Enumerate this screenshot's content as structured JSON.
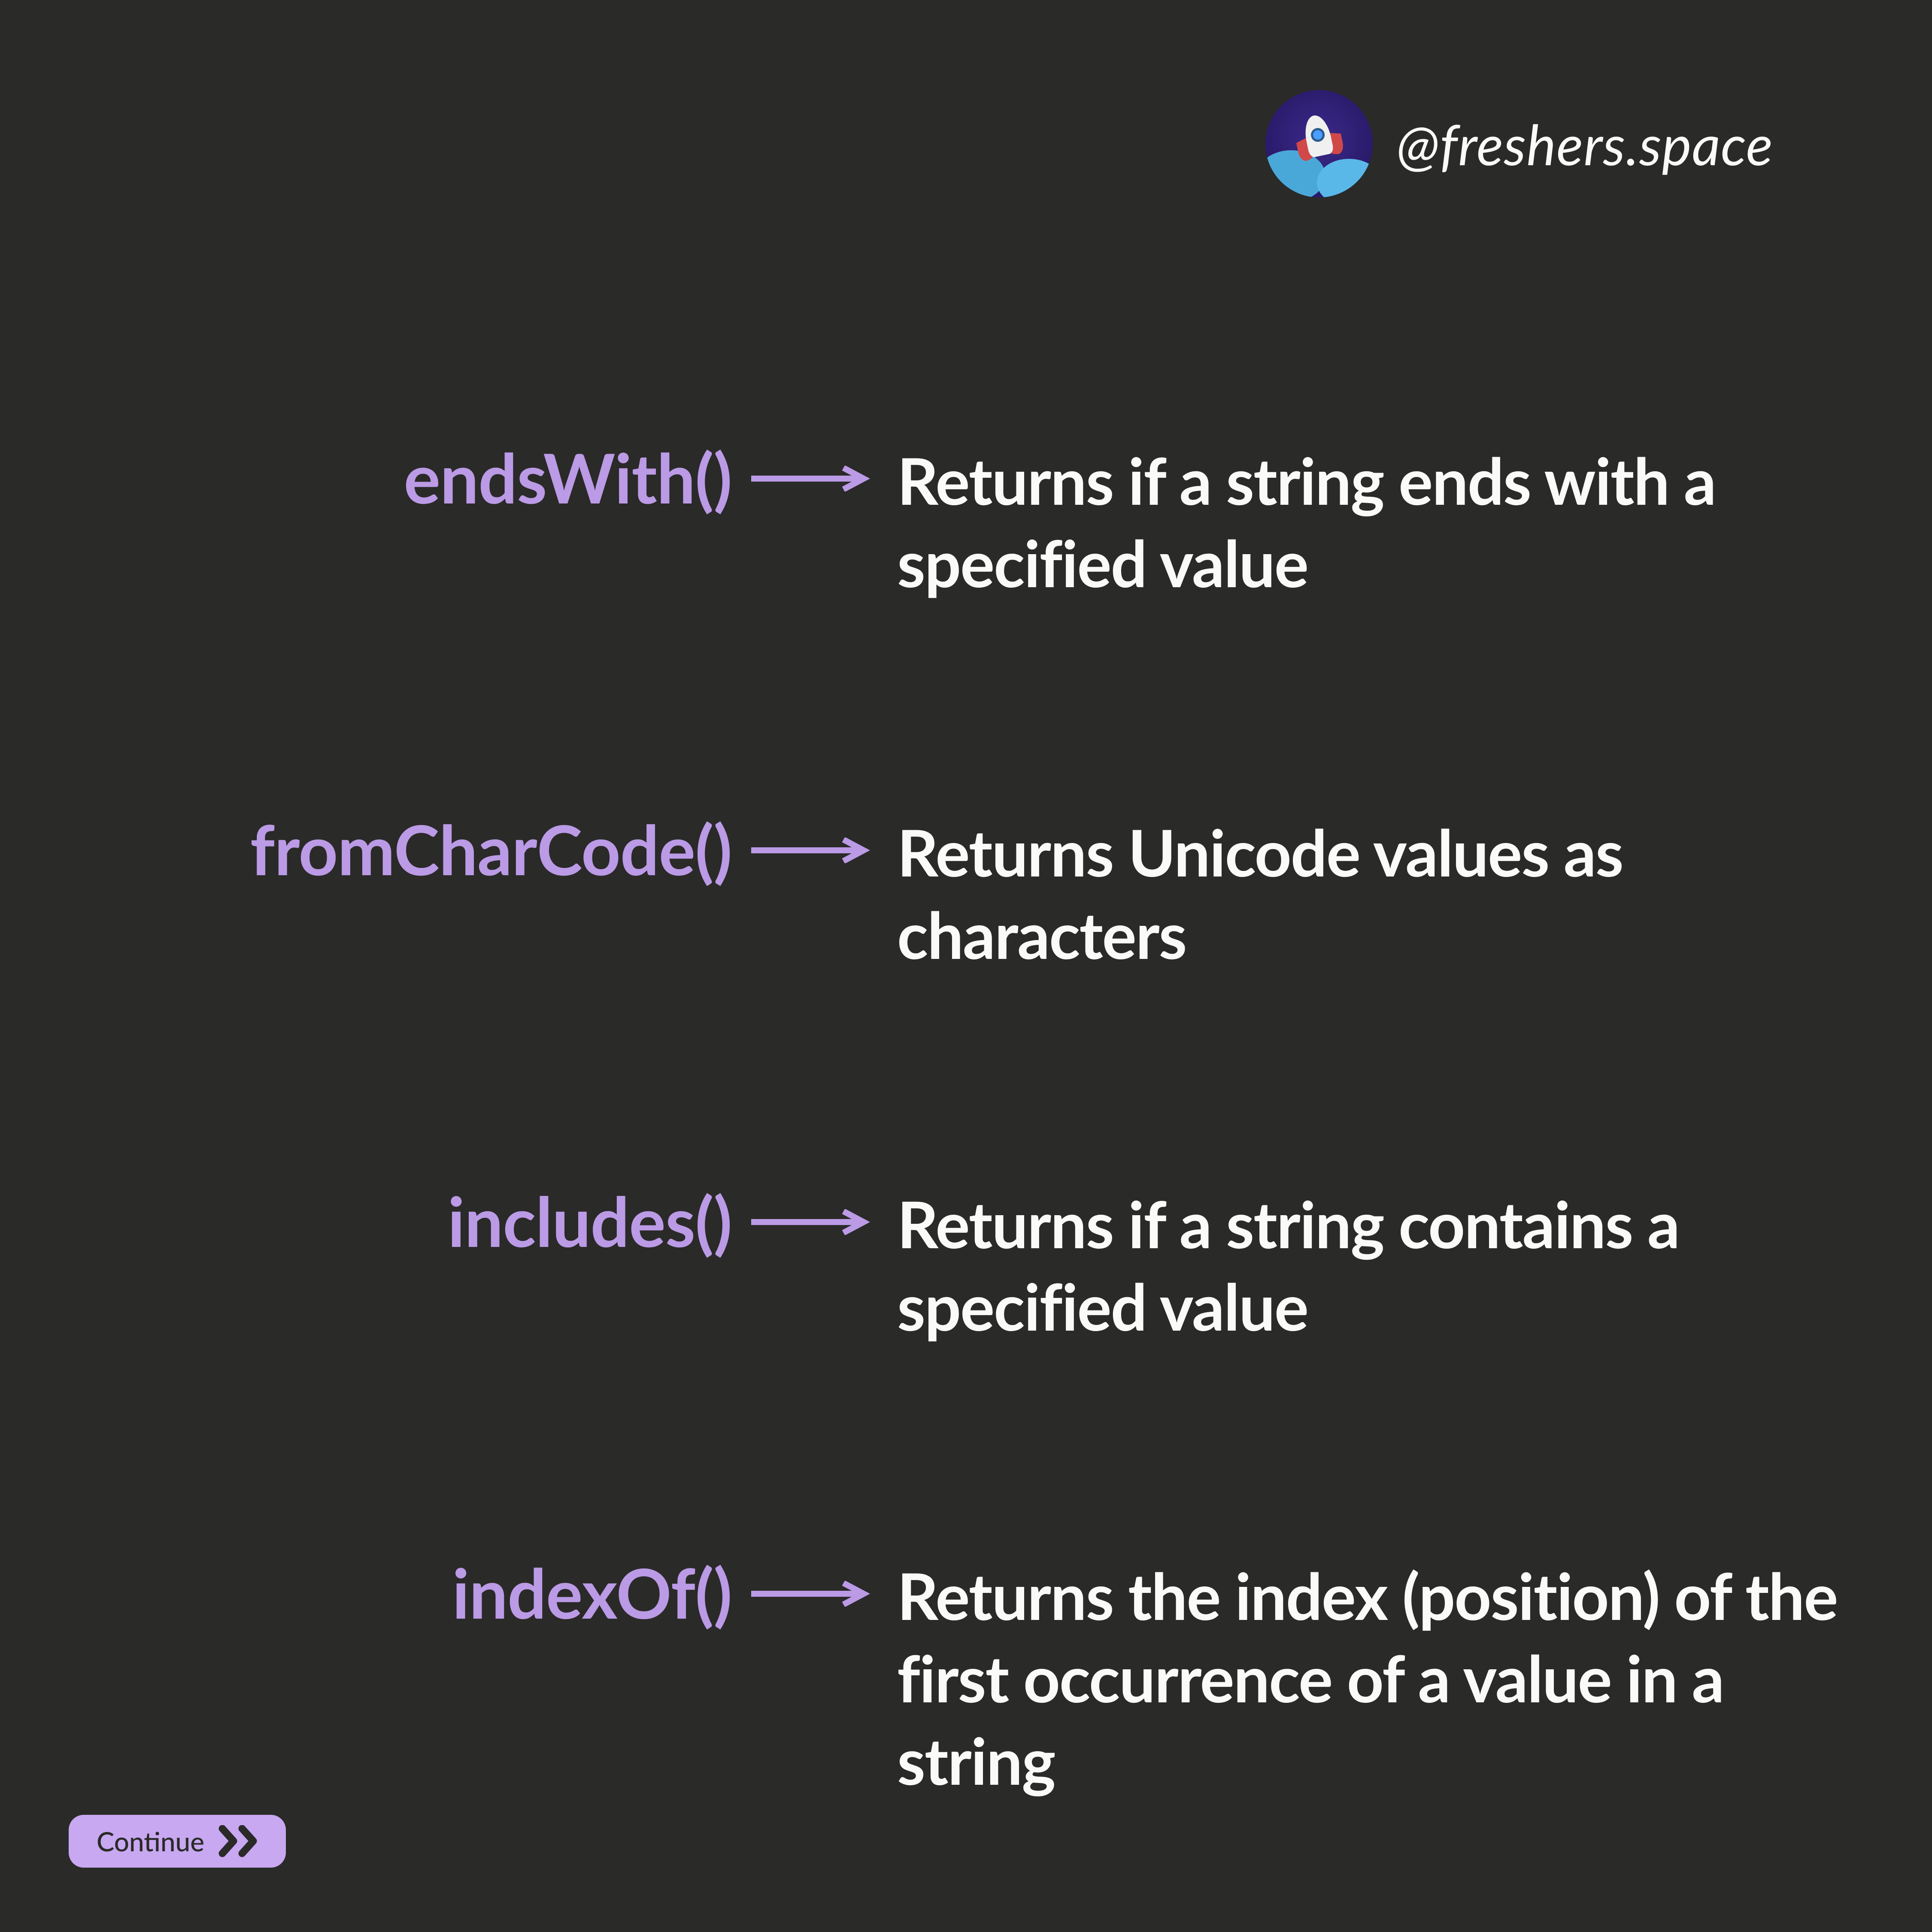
{
  "header": {
    "handle": "@freshers.space"
  },
  "methods": [
    {
      "name": "endsWith()",
      "description": "Returns if a string ends with a specified value"
    },
    {
      "name": "fromCharCode()",
      "description": "Returns Unicode values as characters"
    },
    {
      "name": "includes()",
      "description": "Returns if a string contains a specified value"
    },
    {
      "name": "indexOf()",
      "description": "Returns the index (position) of the first occurrence of a value in a string"
    }
  ],
  "footer": {
    "continue_label": "Continue"
  }
}
